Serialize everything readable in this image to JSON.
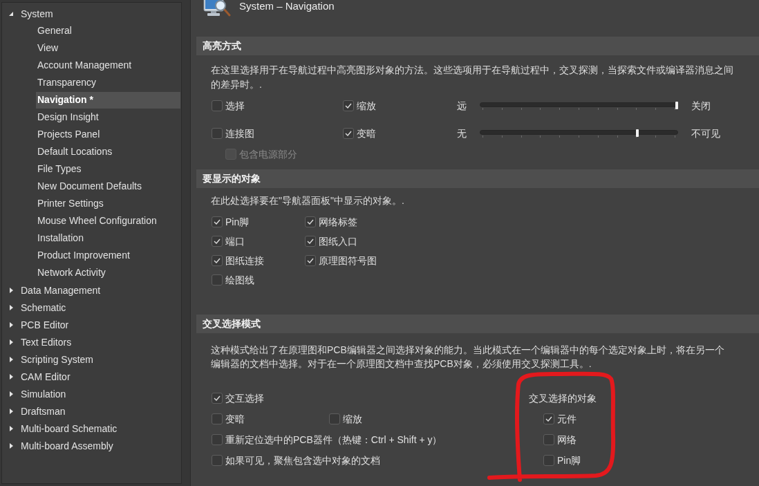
{
  "sidebar": {
    "items": [
      {
        "label": "System",
        "expanded": true,
        "selected": false,
        "children": [
          {
            "label": "General",
            "selected": false
          },
          {
            "label": "View",
            "selected": false
          },
          {
            "label": "Account Management",
            "selected": false
          },
          {
            "label": "Transparency",
            "selected": false
          },
          {
            "label": "Navigation *",
            "selected": true
          },
          {
            "label": "Design Insight",
            "selected": false
          },
          {
            "label": "Projects Panel",
            "selected": false
          },
          {
            "label": "Default Locations",
            "selected": false
          },
          {
            "label": "File Types",
            "selected": false
          },
          {
            "label": "New Document Defaults",
            "selected": false
          },
          {
            "label": "Printer Settings",
            "selected": false
          },
          {
            "label": "Mouse Wheel Configuration",
            "selected": false
          },
          {
            "label": "Installation",
            "selected": false
          },
          {
            "label": "Product Improvement",
            "selected": false
          },
          {
            "label": "Network Activity",
            "selected": false
          }
        ]
      },
      {
        "label": "Data Management",
        "expanded": false,
        "selected": false
      },
      {
        "label": "Schematic",
        "expanded": false,
        "selected": false
      },
      {
        "label": "PCB Editor",
        "expanded": false,
        "selected": false
      },
      {
        "label": "Text Editors",
        "expanded": false,
        "selected": false
      },
      {
        "label": "Scripting System",
        "expanded": false,
        "selected": false
      },
      {
        "label": "CAM Editor",
        "expanded": false,
        "selected": false
      },
      {
        "label": "Simulation",
        "expanded": false,
        "selected": false
      },
      {
        "label": "Draftsman",
        "expanded": false,
        "selected": false
      },
      {
        "label": "Multi-board Schematic",
        "expanded": false,
        "selected": false
      },
      {
        "label": "Multi-board Assembly",
        "expanded": false,
        "selected": false
      }
    ]
  },
  "page": {
    "title": "System – Navigation"
  },
  "highlight": {
    "title": "高亮方式",
    "description": "在这里选择用于在导航过程中高亮图形对象的方法。这些选项用于在导航过程中，交叉探测，当探索文件或编译器消息之间的差异时。.",
    "rows": [
      {
        "options": [
          {
            "label": "选择",
            "checked": false
          },
          {
            "label": "缩放",
            "checked": true
          }
        ],
        "slider": {
          "min_label": "远",
          "level": 1,
          "max_label": "关闭"
        }
      },
      {
        "options": [
          {
            "label": "连接图",
            "checked": false
          },
          {
            "label": "变暗",
            "checked": true
          }
        ],
        "slider": {
          "min_label": "无",
          "level": 0.8,
          "max_label": "不可见"
        }
      }
    ],
    "sub_option": {
      "label": "包含电源部分",
      "checked": false,
      "disabled": true
    }
  },
  "objects_to_show": {
    "title": "要显示的对象",
    "description": "在此处选择要在\"导航器面板\"中显示的对象。.",
    "options": [
      {
        "label": "Pin脚",
        "checked": true
      },
      {
        "label": "网络标签",
        "checked": true
      },
      {
        "label": "端口",
        "checked": true
      },
      {
        "label": "图纸入口",
        "checked": true
      },
      {
        "label": "图纸连接",
        "checked": true
      },
      {
        "label": "原理图符号图",
        "checked": true
      },
      {
        "label": "绘图线",
        "checked": false
      }
    ]
  },
  "cross_select": {
    "title": "交叉选择模式",
    "description": "这种模式给出了在原理图和PCB编辑器之间选择对象的能力。当此模式在一个编辑器中的每个选定对象上时，将在另一个编辑器的文档中选择。对于在一个原理图文档中查找PCB对象，必须使用交叉探测工具。.",
    "options": [
      [
        {
          "label": "交互选择",
          "checked": true
        }
      ],
      [
        {
          "label": "变暗",
          "checked": false
        },
        {
          "label": "缩放",
          "checked": false
        }
      ],
      [
        {
          "label": "重新定位选中的PCB器件（热键：Ctrl + Shift + y）",
          "checked": false
        }
      ],
      [
        {
          "label": "如果可见，聚焦包含选中对象的文档",
          "checked": false
        }
      ]
    ],
    "objects": {
      "title": "交叉选择的对象",
      "options": [
        {
          "label": "元件",
          "checked": true
        },
        {
          "label": "网络",
          "checked": false
        },
        {
          "label": "Pin脚",
          "checked": false
        }
      ]
    }
  },
  "markup": [
    {
      "kind": "loop"
    }
  ]
}
